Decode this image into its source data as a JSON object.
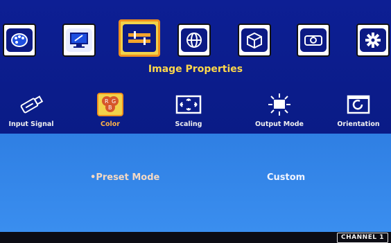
{
  "menu": {
    "title": "Image Properties",
    "top_icons": [
      {
        "icon": "palette-icon"
      },
      {
        "icon": "monitor-settings-icon"
      },
      {
        "icon": "image-properties-icon",
        "selected": true
      },
      {
        "icon": "globe-icon"
      },
      {
        "icon": "cube-icon"
      },
      {
        "icon": "projector-icon"
      },
      {
        "icon": "gear-icon"
      }
    ],
    "sub_items": [
      {
        "label": "Input Signal",
        "icon": "usb-icon"
      },
      {
        "label": "Color",
        "icon": "rgb-icon",
        "active": true
      },
      {
        "label": "Scaling",
        "icon": "scaling-icon"
      },
      {
        "label": "Output Mode",
        "icon": "output-mode-icon"
      },
      {
        "label": "Orientation",
        "icon": "orientation-icon"
      }
    ]
  },
  "setting": {
    "label": "Preset Mode",
    "bullet": "•",
    "value": "Custom"
  },
  "status": {
    "channel": "CHANNEL 1"
  },
  "colors": {
    "accent_title": "#ffd84a",
    "selected_tile": "#f2d24a",
    "panel": "#3a8eef"
  }
}
